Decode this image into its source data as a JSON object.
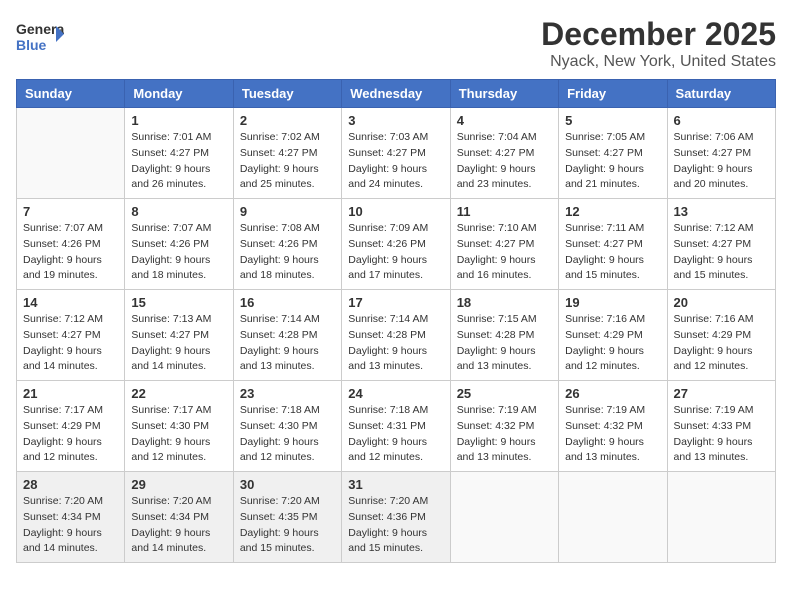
{
  "header": {
    "logo_text_general": "General",
    "logo_text_blue": "Blue",
    "title": "December 2025",
    "subtitle": "Nyack, New York, United States"
  },
  "calendar": {
    "days_of_week": [
      "Sunday",
      "Monday",
      "Tuesday",
      "Wednesday",
      "Thursday",
      "Friday",
      "Saturday"
    ],
    "weeks": [
      [
        {
          "day": "",
          "sunrise": "",
          "sunset": "",
          "daylight": "",
          "empty": true
        },
        {
          "day": "1",
          "sunrise": "Sunrise: 7:01 AM",
          "sunset": "Sunset: 4:27 PM",
          "daylight": "Daylight: 9 hours and 26 minutes."
        },
        {
          "day": "2",
          "sunrise": "Sunrise: 7:02 AM",
          "sunset": "Sunset: 4:27 PM",
          "daylight": "Daylight: 9 hours and 25 minutes."
        },
        {
          "day": "3",
          "sunrise": "Sunrise: 7:03 AM",
          "sunset": "Sunset: 4:27 PM",
          "daylight": "Daylight: 9 hours and 24 minutes."
        },
        {
          "day": "4",
          "sunrise": "Sunrise: 7:04 AM",
          "sunset": "Sunset: 4:27 PM",
          "daylight": "Daylight: 9 hours and 23 minutes."
        },
        {
          "day": "5",
          "sunrise": "Sunrise: 7:05 AM",
          "sunset": "Sunset: 4:27 PM",
          "daylight": "Daylight: 9 hours and 21 minutes."
        },
        {
          "day": "6",
          "sunrise": "Sunrise: 7:06 AM",
          "sunset": "Sunset: 4:27 PM",
          "daylight": "Daylight: 9 hours and 20 minutes."
        }
      ],
      [
        {
          "day": "7",
          "sunrise": "Sunrise: 7:07 AM",
          "sunset": "Sunset: 4:26 PM",
          "daylight": "Daylight: 9 hours and 19 minutes."
        },
        {
          "day": "8",
          "sunrise": "Sunrise: 7:07 AM",
          "sunset": "Sunset: 4:26 PM",
          "daylight": "Daylight: 9 hours and 18 minutes."
        },
        {
          "day": "9",
          "sunrise": "Sunrise: 7:08 AM",
          "sunset": "Sunset: 4:26 PM",
          "daylight": "Daylight: 9 hours and 18 minutes."
        },
        {
          "day": "10",
          "sunrise": "Sunrise: 7:09 AM",
          "sunset": "Sunset: 4:26 PM",
          "daylight": "Daylight: 9 hours and 17 minutes."
        },
        {
          "day": "11",
          "sunrise": "Sunrise: 7:10 AM",
          "sunset": "Sunset: 4:27 PM",
          "daylight": "Daylight: 9 hours and 16 minutes."
        },
        {
          "day": "12",
          "sunrise": "Sunrise: 7:11 AM",
          "sunset": "Sunset: 4:27 PM",
          "daylight": "Daylight: 9 hours and 15 minutes."
        },
        {
          "day": "13",
          "sunrise": "Sunrise: 7:12 AM",
          "sunset": "Sunset: 4:27 PM",
          "daylight": "Daylight: 9 hours and 15 minutes."
        }
      ],
      [
        {
          "day": "14",
          "sunrise": "Sunrise: 7:12 AM",
          "sunset": "Sunset: 4:27 PM",
          "daylight": "Daylight: 9 hours and 14 minutes."
        },
        {
          "day": "15",
          "sunrise": "Sunrise: 7:13 AM",
          "sunset": "Sunset: 4:27 PM",
          "daylight": "Daylight: 9 hours and 14 minutes."
        },
        {
          "day": "16",
          "sunrise": "Sunrise: 7:14 AM",
          "sunset": "Sunset: 4:28 PM",
          "daylight": "Daylight: 9 hours and 13 minutes."
        },
        {
          "day": "17",
          "sunrise": "Sunrise: 7:14 AM",
          "sunset": "Sunset: 4:28 PM",
          "daylight": "Daylight: 9 hours and 13 minutes."
        },
        {
          "day": "18",
          "sunrise": "Sunrise: 7:15 AM",
          "sunset": "Sunset: 4:28 PM",
          "daylight": "Daylight: 9 hours and 13 minutes."
        },
        {
          "day": "19",
          "sunrise": "Sunrise: 7:16 AM",
          "sunset": "Sunset: 4:29 PM",
          "daylight": "Daylight: 9 hours and 12 minutes."
        },
        {
          "day": "20",
          "sunrise": "Sunrise: 7:16 AM",
          "sunset": "Sunset: 4:29 PM",
          "daylight": "Daylight: 9 hours and 12 minutes."
        }
      ],
      [
        {
          "day": "21",
          "sunrise": "Sunrise: 7:17 AM",
          "sunset": "Sunset: 4:29 PM",
          "daylight": "Daylight: 9 hours and 12 minutes."
        },
        {
          "day": "22",
          "sunrise": "Sunrise: 7:17 AM",
          "sunset": "Sunset: 4:30 PM",
          "daylight": "Daylight: 9 hours and 12 minutes."
        },
        {
          "day": "23",
          "sunrise": "Sunrise: 7:18 AM",
          "sunset": "Sunset: 4:30 PM",
          "daylight": "Daylight: 9 hours and 12 minutes."
        },
        {
          "day": "24",
          "sunrise": "Sunrise: 7:18 AM",
          "sunset": "Sunset: 4:31 PM",
          "daylight": "Daylight: 9 hours and 12 minutes."
        },
        {
          "day": "25",
          "sunrise": "Sunrise: 7:19 AM",
          "sunset": "Sunset: 4:32 PM",
          "daylight": "Daylight: 9 hours and 13 minutes."
        },
        {
          "day": "26",
          "sunrise": "Sunrise: 7:19 AM",
          "sunset": "Sunset: 4:32 PM",
          "daylight": "Daylight: 9 hours and 13 minutes."
        },
        {
          "day": "27",
          "sunrise": "Sunrise: 7:19 AM",
          "sunset": "Sunset: 4:33 PM",
          "daylight": "Daylight: 9 hours and 13 minutes."
        }
      ],
      [
        {
          "day": "28",
          "sunrise": "Sunrise: 7:20 AM",
          "sunset": "Sunset: 4:34 PM",
          "daylight": "Daylight: 9 hours and 14 minutes."
        },
        {
          "day": "29",
          "sunrise": "Sunrise: 7:20 AM",
          "sunset": "Sunset: 4:34 PM",
          "daylight": "Daylight: 9 hours and 14 minutes."
        },
        {
          "day": "30",
          "sunrise": "Sunrise: 7:20 AM",
          "sunset": "Sunset: 4:35 PM",
          "daylight": "Daylight: 9 hours and 15 minutes."
        },
        {
          "day": "31",
          "sunrise": "Sunrise: 7:20 AM",
          "sunset": "Sunset: 4:36 PM",
          "daylight": "Daylight: 9 hours and 15 minutes."
        },
        {
          "day": "",
          "sunrise": "",
          "sunset": "",
          "daylight": "",
          "empty": true
        },
        {
          "day": "",
          "sunrise": "",
          "sunset": "",
          "daylight": "",
          "empty": true
        },
        {
          "day": "",
          "sunrise": "",
          "sunset": "",
          "daylight": "",
          "empty": true
        }
      ]
    ]
  }
}
